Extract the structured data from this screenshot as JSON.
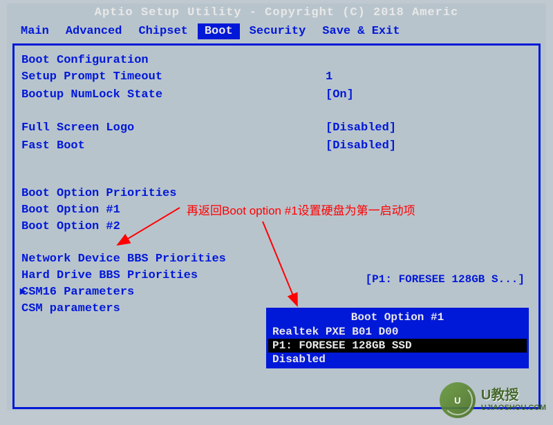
{
  "title": "Aptio Setup Utility - Copyright (C) 2018 Americ",
  "menu": {
    "items": [
      "Main",
      "Advanced",
      "Chipset",
      "Boot",
      "Security",
      "Save & Exit"
    ],
    "active": "Boot"
  },
  "sections": {
    "boot_config": {
      "title": "Boot Configuration",
      "items": [
        {
          "label": "Setup Prompt Timeout",
          "value": "1"
        },
        {
          "label": "Bootup NumLock State",
          "value": "[On]"
        }
      ]
    },
    "display": {
      "items": [
        {
          "label": "Full Screen Logo",
          "value": "[Disabled]"
        },
        {
          "label": "Fast Boot",
          "value": "[Disabled]"
        }
      ]
    },
    "priorities": {
      "title": "Boot Option Priorities",
      "items": [
        {
          "label": "Boot Option #1",
          "highlighted": true
        },
        {
          "label": "Boot Option #2"
        }
      ]
    },
    "submenus": [
      "Network Device BBS Priorities",
      "Hard Drive BBS Priorities",
      "CSM16 Parameters",
      "CSM parameters"
    ]
  },
  "info_text": "[P1: FORESEE 128GB S...]",
  "popup": {
    "title": "Boot Option #1",
    "items": [
      "Realtek PXE B01 D00",
      "P1: FORESEE 128GB SSD",
      "Disabled"
    ],
    "selected": 1
  },
  "annotation": {
    "text": "再返回Boot option #1设置硬盘为第一启动项"
  },
  "watermark": {
    "brand": "U教授",
    "url": "UJIAOSHOU.COM"
  }
}
